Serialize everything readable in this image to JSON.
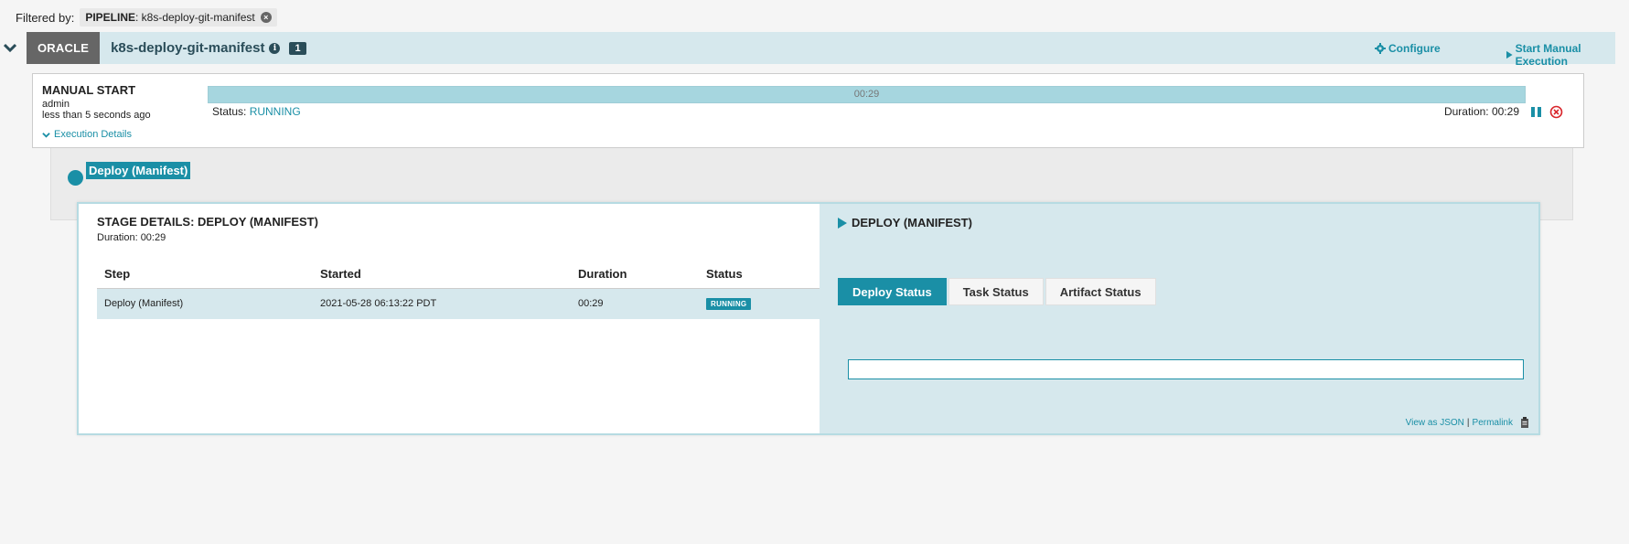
{
  "filter": {
    "prefix": "Filtered by:",
    "tag_key": "PIPELINE",
    "tag_value": ": k8s-deploy-git-manifest"
  },
  "pipeline": {
    "app_badge": "ORACLE",
    "name": "k8s-deploy-git-manifest",
    "execution_count": "1",
    "configure_label": "Configure",
    "manual_label": "Start Manual Execution"
  },
  "execution": {
    "trigger_title": "MANUAL START",
    "user": "admin",
    "time_ago": "less than 5 seconds ago",
    "details_link": "Execution Details",
    "progress_label": "00:29",
    "progress_fraction": 1.0,
    "status_prefix": "Status: ",
    "status_value": "RUNNING",
    "duration": "Duration: 00:29"
  },
  "stage_graph": {
    "stage_label": "Deploy (Manifest)"
  },
  "stage_details": {
    "title": "STAGE DETAILS: DEPLOY (MANIFEST)",
    "duration": "Duration: 00:29",
    "columns": [
      "Step",
      "Started",
      "Duration",
      "Status"
    ],
    "rows": [
      {
        "step": "Deploy (Manifest)",
        "started": "2021-05-28 06:13:22 PDT",
        "duration": "00:29",
        "status": "RUNNING"
      }
    ]
  },
  "right_panel": {
    "title": "DEPLOY (MANIFEST)",
    "tabs": [
      "Deploy Status",
      "Task Status",
      "Artifact Status"
    ],
    "active_tab": "Deploy Status",
    "view_json": "View as JSON",
    "separator": "|",
    "permalink": "Permalink"
  },
  "colors": {
    "accent": "#1a8fa6",
    "header_bg": "#d6e8ed",
    "app_badge_bg": "#666666"
  }
}
